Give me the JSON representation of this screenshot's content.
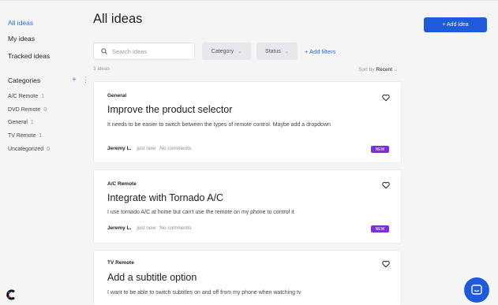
{
  "sidebar": {
    "nav": [
      {
        "label": "All ideas"
      },
      {
        "label": "My ideas"
      },
      {
        "label": "Tracked ideas"
      }
    ],
    "categories_heading": "Categories",
    "categories": [
      {
        "label": "A/C Remote",
        "count": "1"
      },
      {
        "label": "DVD Remote",
        "count": "0"
      },
      {
        "label": "General",
        "count": "1"
      },
      {
        "label": "TV Remote",
        "count": "1"
      },
      {
        "label": "Uncategorized",
        "count": "0"
      }
    ]
  },
  "header": {
    "title": "All ideas",
    "add_button": "+ Add idea"
  },
  "filters": {
    "search_placeholder": "Search Ideas",
    "category": "Category",
    "status": "Status",
    "add_filters": "+ Add filters"
  },
  "list": {
    "count_label": "3 ideas",
    "sort_prefix": "Sort by",
    "sort_value": "Recent"
  },
  "ideas": [
    {
      "category": "General",
      "title": "Improve the product selector",
      "description": "It needs to be easier to switch between the types of remote control. Maybe add a dropdown",
      "author": "Jeremy L.",
      "time": "just now",
      "comments": "No comments",
      "badge": "NEW"
    },
    {
      "category": "A/C Remote",
      "title": "Integrate with Tornado A/C",
      "description": "I use tornado A/C at home but can't use the remote on my phone to control it",
      "author": "Jeremy L.",
      "time": "just now",
      "comments": "No comments",
      "badge": "NEW"
    },
    {
      "category": "TV Remote",
      "title": "Add a subtitle option",
      "description": "I want to be able to switch subtitles on and off from my phone when watching tv"
    }
  ],
  "colors": {
    "accent": "#1e5bdc",
    "link": "#2f6bd8",
    "badge": "#7b2fd8",
    "background": "#f5f5f6"
  },
  "icons": {
    "search": "search-icon",
    "heart": "heart-icon",
    "chat": "chat-icon",
    "logo": "logo-icon"
  }
}
